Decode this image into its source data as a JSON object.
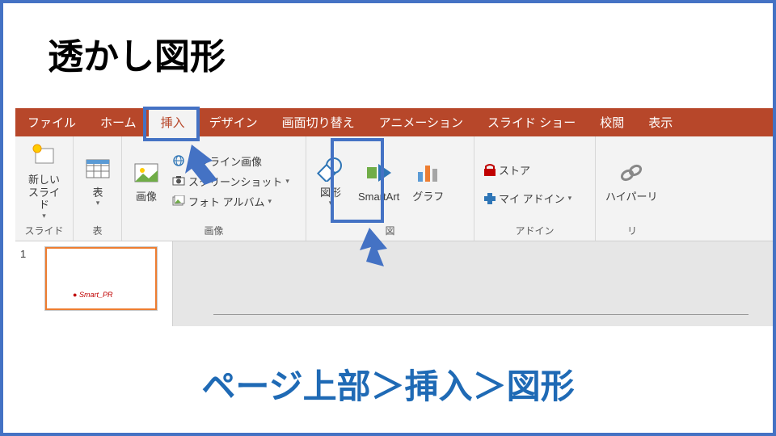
{
  "slide_title": "透かし図形",
  "tabs": {
    "file": "ファイル",
    "home": "ホーム",
    "insert": "挿入",
    "design": "デザイン",
    "transition": "画面切り替え",
    "animation": "アニメーション",
    "slideshow": "スライド ショー",
    "review": "校閲",
    "view": "表示"
  },
  "groups": {
    "slides_label": "スライド",
    "tables_label": "表",
    "images_label": "画像",
    "illustrations_label": "図",
    "addins_label": "アドイン",
    "links_label": "リ"
  },
  "buttons": {
    "new_slide": "新しい\nスライド",
    "table": "表",
    "pictures": "画像",
    "online_pictures": "オンライン画像",
    "screenshot": "スクリーンショット",
    "photo_album": "フォト アルバム",
    "shapes": "図形",
    "smartart": "SmartArt",
    "chart": "グラフ",
    "store": "ストア",
    "my_addins": "マイ アドイン",
    "hyperlink": "ハイパーリ"
  },
  "thumbnails": {
    "slide1": "1",
    "logo_text": "Smart_PR"
  },
  "bottom_caption": "ページ上部＞挿入＞図形"
}
